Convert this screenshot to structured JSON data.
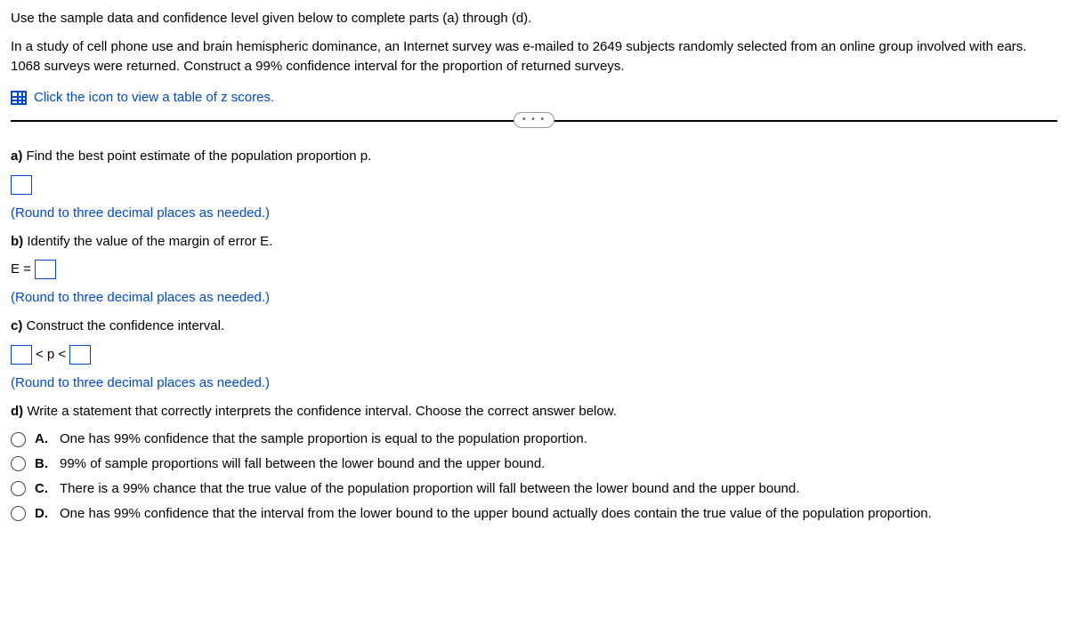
{
  "instruction": "Use the sample data and confidence level given below to complete parts (a) through (d).",
  "problem": "In a study of cell phone use and brain hemispheric dominance, an Internet survey was e-mailed to 2649 subjects randomly selected from an online group involved with ears. 1068 surveys were returned. Construct a 99% confidence interval for the proportion of returned surveys.",
  "z_link": "Click the icon to view a table of z scores.",
  "more": "• • •",
  "a": {
    "label": "a)",
    "text": " Find the best point estimate of the population proportion p.",
    "hint": "(Round to three decimal places as needed.)"
  },
  "b": {
    "label": "b)",
    "text": " Identify the value of the margin of error E.",
    "prefix": "E =",
    "hint": "(Round to three decimal places as needed.)"
  },
  "c": {
    "label": "c)",
    "text": " Construct the confidence interval.",
    "mid": "< p <",
    "hint": "(Round to three decimal places as needed.)"
  },
  "d": {
    "label": "d)",
    "text": " Write a statement that correctly interprets the confidence interval. Choose the correct answer below."
  },
  "choices": [
    {
      "letter": "A.",
      "text": "One has 99% confidence that the sample proportion is equal to the population proportion."
    },
    {
      "letter": "B.",
      "text": "99% of sample proportions will fall between the lower bound and the upper bound."
    },
    {
      "letter": "C.",
      "text": "There is a 99% chance that the true value of the population proportion will fall between the lower bound and the upper bound."
    },
    {
      "letter": "D.",
      "text": "One has 99% confidence that the interval from the lower bound to the upper bound actually does contain the true value of the population proportion."
    }
  ]
}
